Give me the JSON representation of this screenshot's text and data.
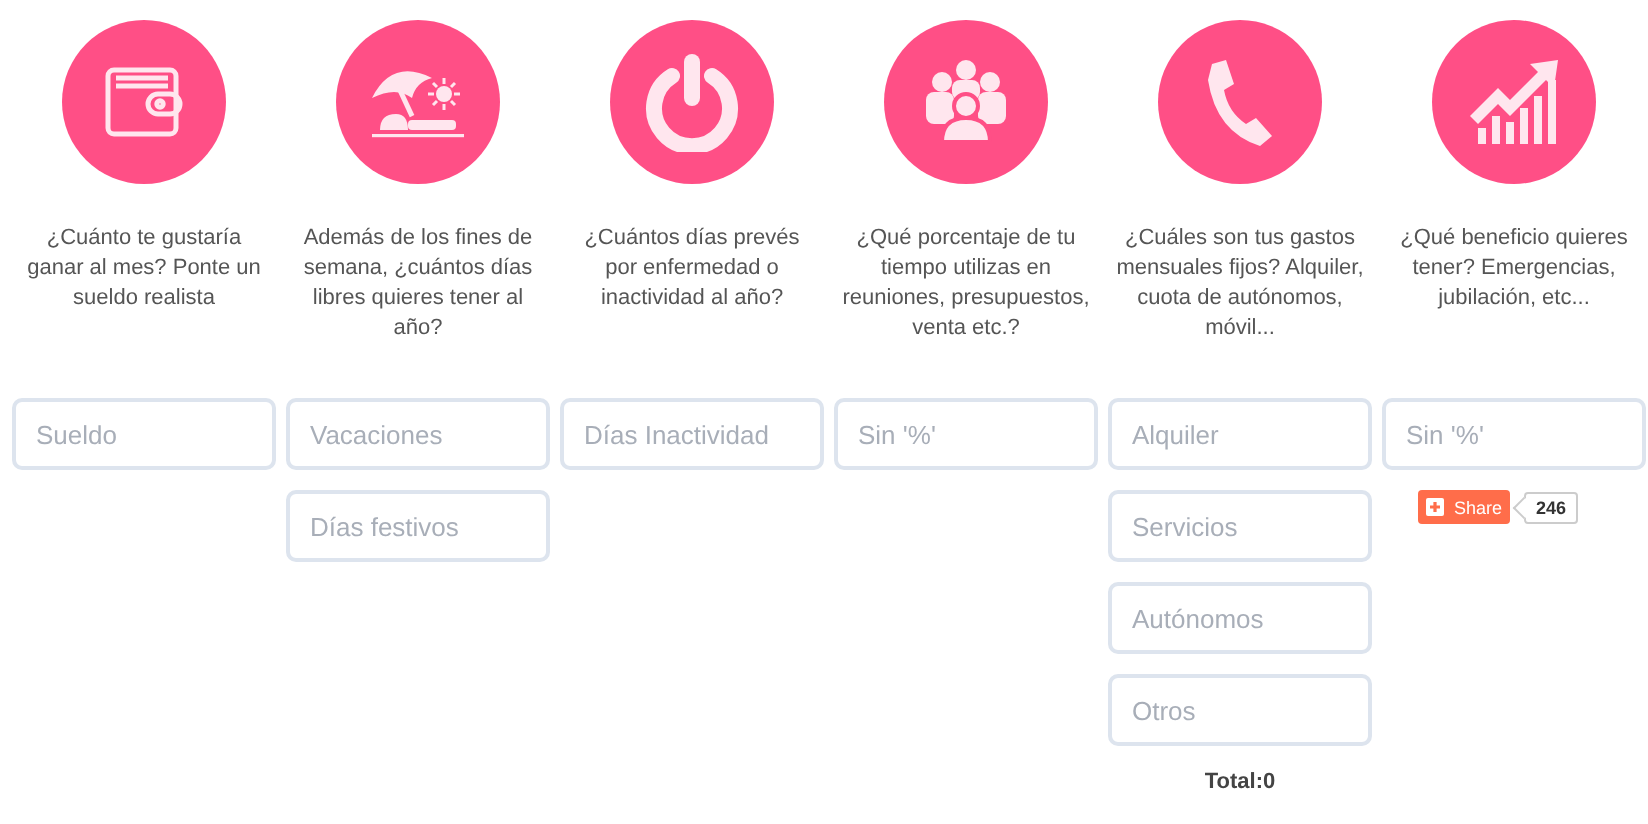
{
  "columns": [
    {
      "kind": "wallet",
      "question": "¿Cuánto te gustaría ganar al mes? Ponte un sueldo realista",
      "fields": [
        {
          "placeholder": "Sueldo"
        }
      ]
    },
    {
      "kind": "beach",
      "question": "Además de los fines de semana, ¿cuántos días libres quieres tener al año?",
      "fields": [
        {
          "placeholder": "Vacaciones"
        },
        {
          "placeholder": "Días festivos"
        }
      ]
    },
    {
      "kind": "power",
      "question": "¿Cuántos días prevés por enfermedad o inactividad al año?",
      "fields": [
        {
          "placeholder": "Días Inactividad"
        }
      ]
    },
    {
      "kind": "people",
      "question": "¿Qué porcentaje de tu tiempo utilizas en reuniones, presupuestos, venta etc.?",
      "fields": [
        {
          "placeholder": "Sin '%'"
        }
      ]
    },
    {
      "kind": "phone",
      "question": "¿Cuáles son tus gastos mensuales fijos? Alquiler, cuota de autónomos, móvil...",
      "fields": [
        {
          "placeholder": "Alquiler"
        },
        {
          "placeholder": "Servicios"
        },
        {
          "placeholder": "Autónomos"
        },
        {
          "placeholder": "Otros"
        }
      ],
      "total": "Total:0"
    },
    {
      "kind": "chart",
      "question": "¿Qué beneficio quieres tener? Emergencias, jubilación, etc...",
      "fields": [
        {
          "placeholder": "Sin '%'"
        }
      ],
      "share": {
        "label": "Share",
        "count": "246"
      }
    }
  ]
}
